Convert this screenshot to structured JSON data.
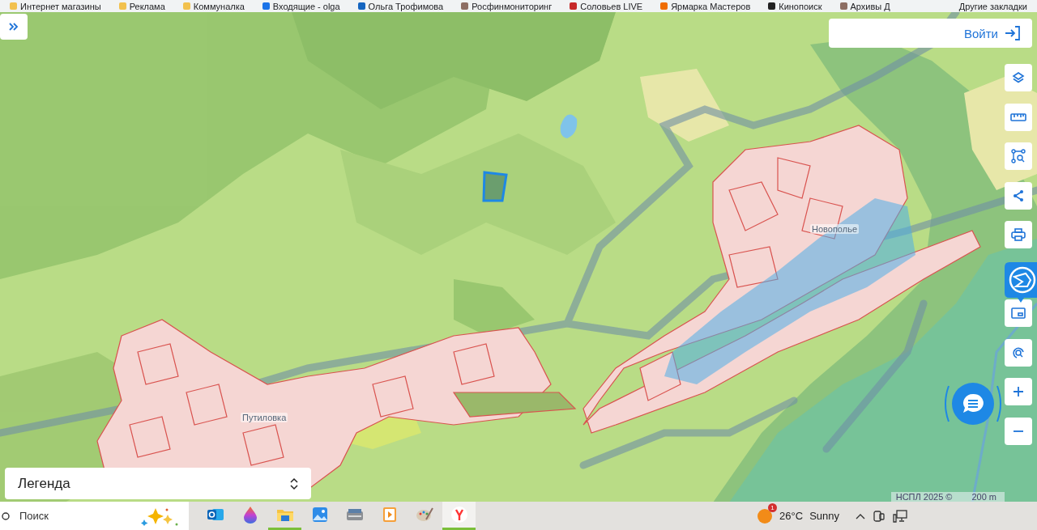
{
  "bookmarks_bar": {
    "items": [
      {
        "label": "Интернет магазины",
        "kind": "folder"
      },
      {
        "label": "Реклама",
        "kind": "folder"
      },
      {
        "label": "Коммуналка",
        "kind": "folder"
      },
      {
        "label": "Входящие - olga",
        "kind": "mail"
      },
      {
        "label": "Ольга Трофимова",
        "kind": "profile"
      },
      {
        "label": "Росфинмониторинг",
        "kind": "site"
      },
      {
        "label": "Соловьев LIVE",
        "kind": "video"
      },
      {
        "label": "Ярмарка Мастеров",
        "kind": "shop"
      },
      {
        "label": "Кинопоиск",
        "kind": "movie"
      },
      {
        "label": "Архивы Д",
        "kind": "site"
      }
    ],
    "other": "Другие закладки"
  },
  "map": {
    "login_button": "Войти",
    "place_labels": [
      {
        "name": "Новополье",
        "kind": "village_east"
      },
      {
        "name": "Путиловка",
        "kind": "village_west"
      }
    ],
    "legend": {
      "label": "Легенда"
    },
    "attribution": "НСПЛ 2025 ©",
    "scale": "200 m"
  },
  "taskbar": {
    "search": {
      "placeholder": "Поиск"
    },
    "apps": [
      {
        "kind": "mail",
        "open": false,
        "selected": false
      },
      {
        "kind": "paint3d",
        "open": false,
        "selected": false
      },
      {
        "kind": "files",
        "open": true,
        "selected": false
      },
      {
        "kind": "photos",
        "open": false,
        "selected": false
      },
      {
        "kind": "scanner",
        "open": false,
        "selected": false
      },
      {
        "kind": "media",
        "open": false,
        "selected": false
      },
      {
        "kind": "palette",
        "open": false,
        "selected": false
      },
      {
        "kind": "browser",
        "open": true,
        "selected": true
      }
    ],
    "weather": {
      "temperature": "26°C",
      "condition": "Sunny",
      "badge": "1"
    }
  }
}
